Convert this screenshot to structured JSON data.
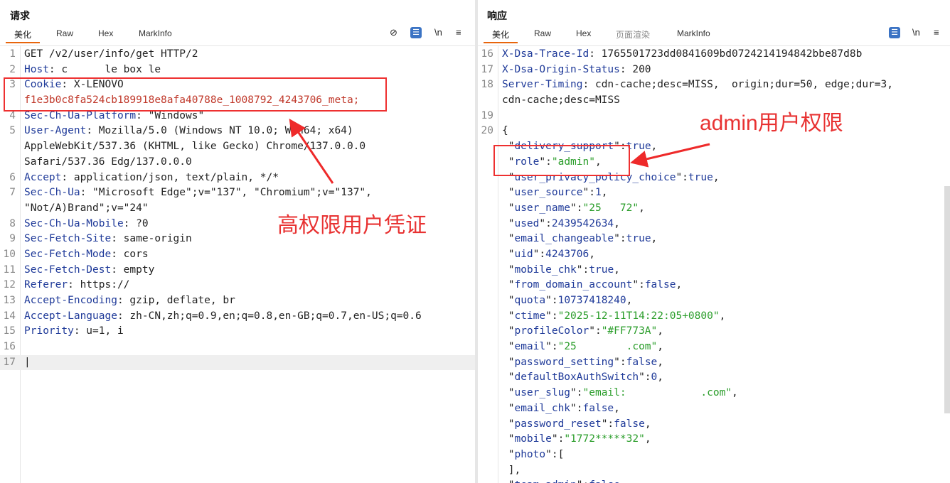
{
  "request": {
    "title": "请求",
    "tabs": [
      "美化",
      "Raw",
      "Hex",
      "MarkInfo"
    ],
    "tools": {
      "hide": "⊘",
      "format": "☰",
      "newline": "\\n",
      "menu": "≡"
    },
    "lines": [
      {
        "n": "1",
        "t": "GET /v2/user/info/get HTTP/2"
      },
      {
        "n": "2",
        "k": "Host",
        "v": " c      le box le"
      },
      {
        "n": "3",
        "k": "Cookie",
        "v": " X-LENOVO    "
      },
      {
        "n": "",
        "t": "f1e3b0c8fa524cb189918e8afa40788e_1008792_4243706_meta;"
      },
      {
        "n": "4",
        "k": "Sec-Ch-Ua-Platform",
        "v": " \"Windows\""
      },
      {
        "n": "5",
        "k": "User-Agent",
        "v": " Mozilla/5.0 (Windows NT 10.0; Win64; x64)"
      },
      {
        "n": "",
        "t": "AppleWebKit/537.36 (KHTML, like Gecko) Chrome/137.0.0.0"
      },
      {
        "n": "",
        "t": "Safari/537.36 Edg/137.0.0.0"
      },
      {
        "n": "6",
        "k": "Accept",
        "v": " application/json, text/plain, */*"
      },
      {
        "n": "7",
        "k": "Sec-Ch-Ua",
        "v": " \"Microsoft Edge\";v=\"137\", \"Chromium\";v=\"137\","
      },
      {
        "n": "",
        "t": "\"Not/A)Brand\";v=\"24\""
      },
      {
        "n": "8",
        "k": "Sec-Ch-Ua-Mobile",
        "v": " ?0"
      },
      {
        "n": "9",
        "k": "Sec-Fetch-Site",
        "v": " same-origin"
      },
      {
        "n": "10",
        "k": "Sec-Fetch-Mode",
        "v": " cors"
      },
      {
        "n": "11",
        "k": "Sec-Fetch-Dest",
        "v": " empty"
      },
      {
        "n": "12",
        "k": "Referer",
        "v": " https://"
      },
      {
        "n": "13",
        "k": "Accept-Encoding",
        "v": " gzip, deflate, br"
      },
      {
        "n": "14",
        "k": "Accept-Language",
        "v": " zh-CN,zh;q=0.9,en;q=0.8,en-GB;q=0.7,en-US;q=0.6"
      },
      {
        "n": "15",
        "k": "Priority",
        "v": " u=1, i"
      },
      {
        "n": "16",
        "t": ""
      },
      {
        "n": "17",
        "t": "|"
      }
    ],
    "annotation": "高权限用户凭证"
  },
  "response": {
    "title": "响应",
    "tabs": [
      "美化",
      "Raw",
      "Hex",
      "页面渲染",
      "MarkInfo"
    ],
    "tools": {
      "format": "☰",
      "newline": "\\n",
      "menu": "≡"
    },
    "lines": [
      {
        "n": "16",
        "k": "X-Dsa-Trace-Id",
        "v": " 1765501723dd0841609bd0724214194842bbe87d8b"
      },
      {
        "n": "17",
        "k": "X-Dsa-Origin-Status",
        "v": " 200"
      },
      {
        "n": "18",
        "k": "Server-Timing",
        "v": " cdn-cache;desc=MISS,  origin;dur=50, edge;dur=3,"
      },
      {
        "n": "",
        "t": "cdn-cache;desc=MISS"
      },
      {
        "n": "19",
        "t": ""
      },
      {
        "n": "20",
        "t": "{"
      },
      {
        "n": "",
        "jk": "delivery_support",
        "jv": "true",
        "vt": "num"
      },
      {
        "n": "",
        "jk": "role",
        "jv": "\"admin\"",
        "vt": "str"
      },
      {
        "n": "",
        "jk": "user_privacy_policy_choice",
        "jv": "true",
        "vt": "num"
      },
      {
        "n": "",
        "jk": "user_source",
        "jv": "1",
        "vt": "num"
      },
      {
        "n": "",
        "jk": "user_name",
        "jv": "\"25   72\"",
        "vt": "str"
      },
      {
        "n": "",
        "jk": "used",
        "jv": "2439542634",
        "vt": "num"
      },
      {
        "n": "",
        "jk": "email_changeable",
        "jv": "true",
        "vt": "num"
      },
      {
        "n": "",
        "jk": "uid",
        "jv": "4243706",
        "vt": "num"
      },
      {
        "n": "",
        "jk": "mobile_chk",
        "jv": "true",
        "vt": "num"
      },
      {
        "n": "",
        "jk": "from_domain_account",
        "jv": "false",
        "vt": "num"
      },
      {
        "n": "",
        "jk": "quota",
        "jv": "10737418240",
        "vt": "num"
      },
      {
        "n": "",
        "jk": "ctime",
        "jv": "\"2025-12-11T14:22:05+0800\"",
        "vt": "str"
      },
      {
        "n": "",
        "jk": "profileColor",
        "jv": "\"#FF773A\"",
        "vt": "str"
      },
      {
        "n": "",
        "jk": "email",
        "jv": "\"25        .com\"",
        "vt": "str"
      },
      {
        "n": "",
        "jk": "password_setting",
        "jv": "false",
        "vt": "num"
      },
      {
        "n": "",
        "jk": "defaultBoxAuthSwitch",
        "jv": "0",
        "vt": "num"
      },
      {
        "n": "",
        "jk": "user_slug",
        "jv": "\"email:            .com\"",
        "vt": "str"
      },
      {
        "n": "",
        "jk": "email_chk",
        "jv": "false",
        "vt": "num"
      },
      {
        "n": "",
        "jk": "password_reset",
        "jv": "false",
        "vt": "num"
      },
      {
        "n": "",
        "jk": "mobile",
        "jv": "\"1772*****32\"",
        "vt": "str"
      },
      {
        "n": "",
        "jk": "photo",
        "jv": "[",
        "vt": "plain",
        "nocomma": true
      },
      {
        "n": "",
        "t": " ],"
      },
      {
        "n": "",
        "jk": "team_admin",
        "jv": "false",
        "vt": "num"
      }
    ],
    "annotation": "admin用户权限"
  }
}
